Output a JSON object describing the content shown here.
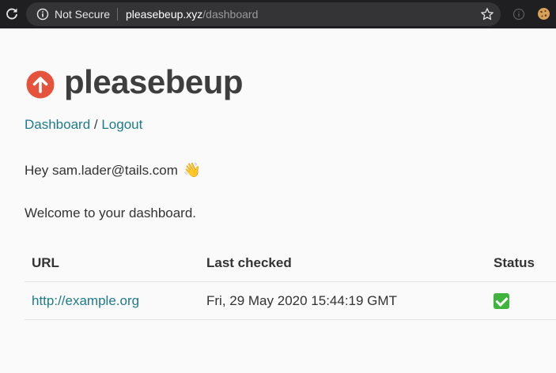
{
  "browser": {
    "security_label": "Not Secure",
    "url_host": "pleasebeup.xyz",
    "url_path": "/dashboard",
    "icons": [
      "reload-icon",
      "info-icon",
      "star-icon",
      "extension-info-icon",
      "cookie-icon"
    ]
  },
  "page": {
    "brand": "pleasebeup",
    "logo_icon": "arrow-up-circle-icon",
    "brand_color": "#e5533d",
    "link_color": "#1f7a8c",
    "nav": {
      "dashboard": "Dashboard",
      "separator": " / ",
      "logout": "Logout"
    },
    "greeting": "Hey sam.lader@tails.com",
    "greeting_emoji": "👋",
    "welcome": "Welcome to your dashboard."
  },
  "table": {
    "headers": {
      "url": "URL",
      "last_checked": "Last checked",
      "status": "Status"
    },
    "rows": [
      {
        "url": "http://example.org",
        "last_checked": "Fri, 29 May 2020 15:44:19 GMT",
        "status": "up",
        "status_icon": "check-mark-icon"
      }
    ]
  }
}
